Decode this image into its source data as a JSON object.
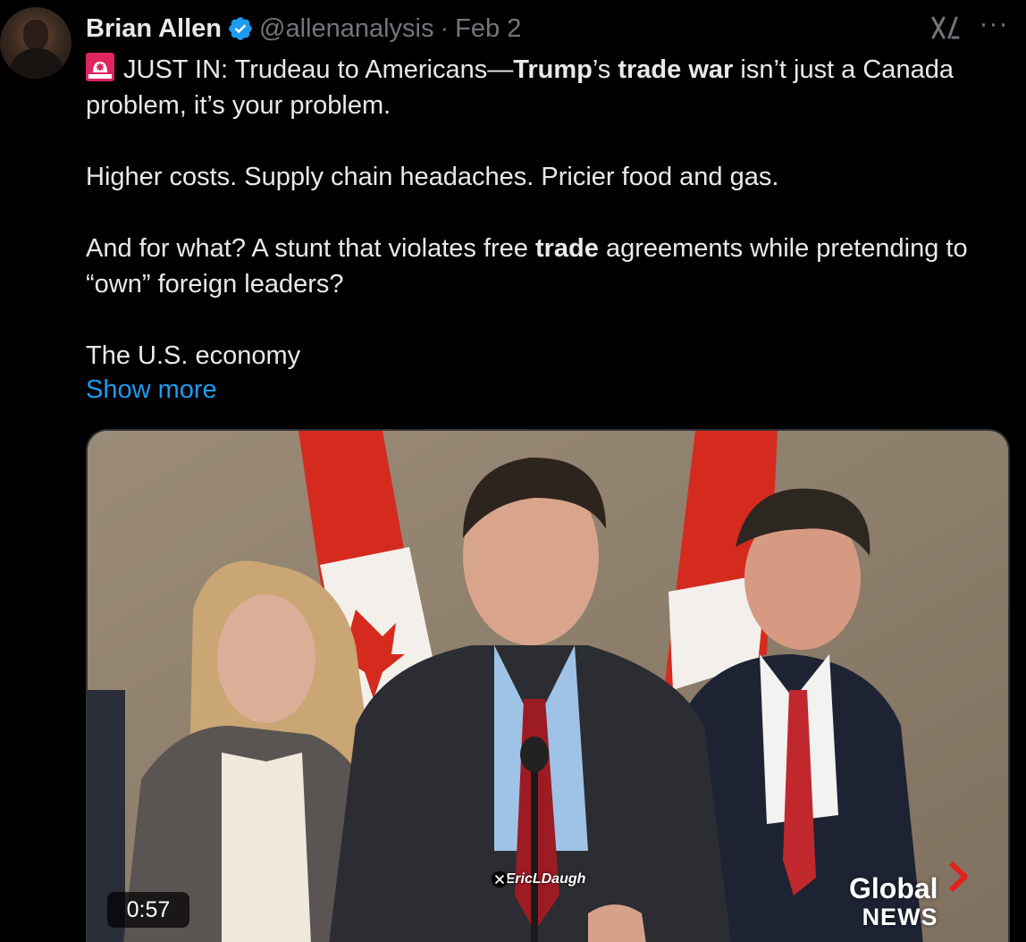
{
  "post": {
    "author_name": "Brian Allen",
    "handle": "@allenanalysis",
    "separator": "·",
    "date": "Feb 2",
    "more_label": "···",
    "lines": {
      "p1_a": "JUST IN: Trudeau to Americans—",
      "p1_b": "Trump",
      "p1_c": "’s ",
      "p1_d": "trade war",
      "p1_e": " isn’t just a Canada problem, it’s your problem.",
      "p2": "Higher costs. Supply chain headaches. Pricier food and gas.",
      "p3_a": "And for what? A stunt that violates free ",
      "p3_b": "trade",
      "p3_c": " agreements while pretending to “own” foreign leaders?",
      "p4": "The U.S. economy"
    },
    "show_more": "Show more"
  },
  "media": {
    "duration": "0:57",
    "watermark": "@EricLDaugh",
    "logo_line1": "Global",
    "logo_line2": "NEWS"
  },
  "colors": {
    "background": "#000000",
    "text": "#e7e9ea",
    "muted": "#71767b",
    "link": "#1d9bf0",
    "verified": "#1d9bf0",
    "siren": "#e0245e"
  },
  "icons": {
    "verified": "verified-badge-icon",
    "siren": "rotating-light-emoji-icon",
    "grok": "grok-icon",
    "more": "more-options-icon"
  }
}
